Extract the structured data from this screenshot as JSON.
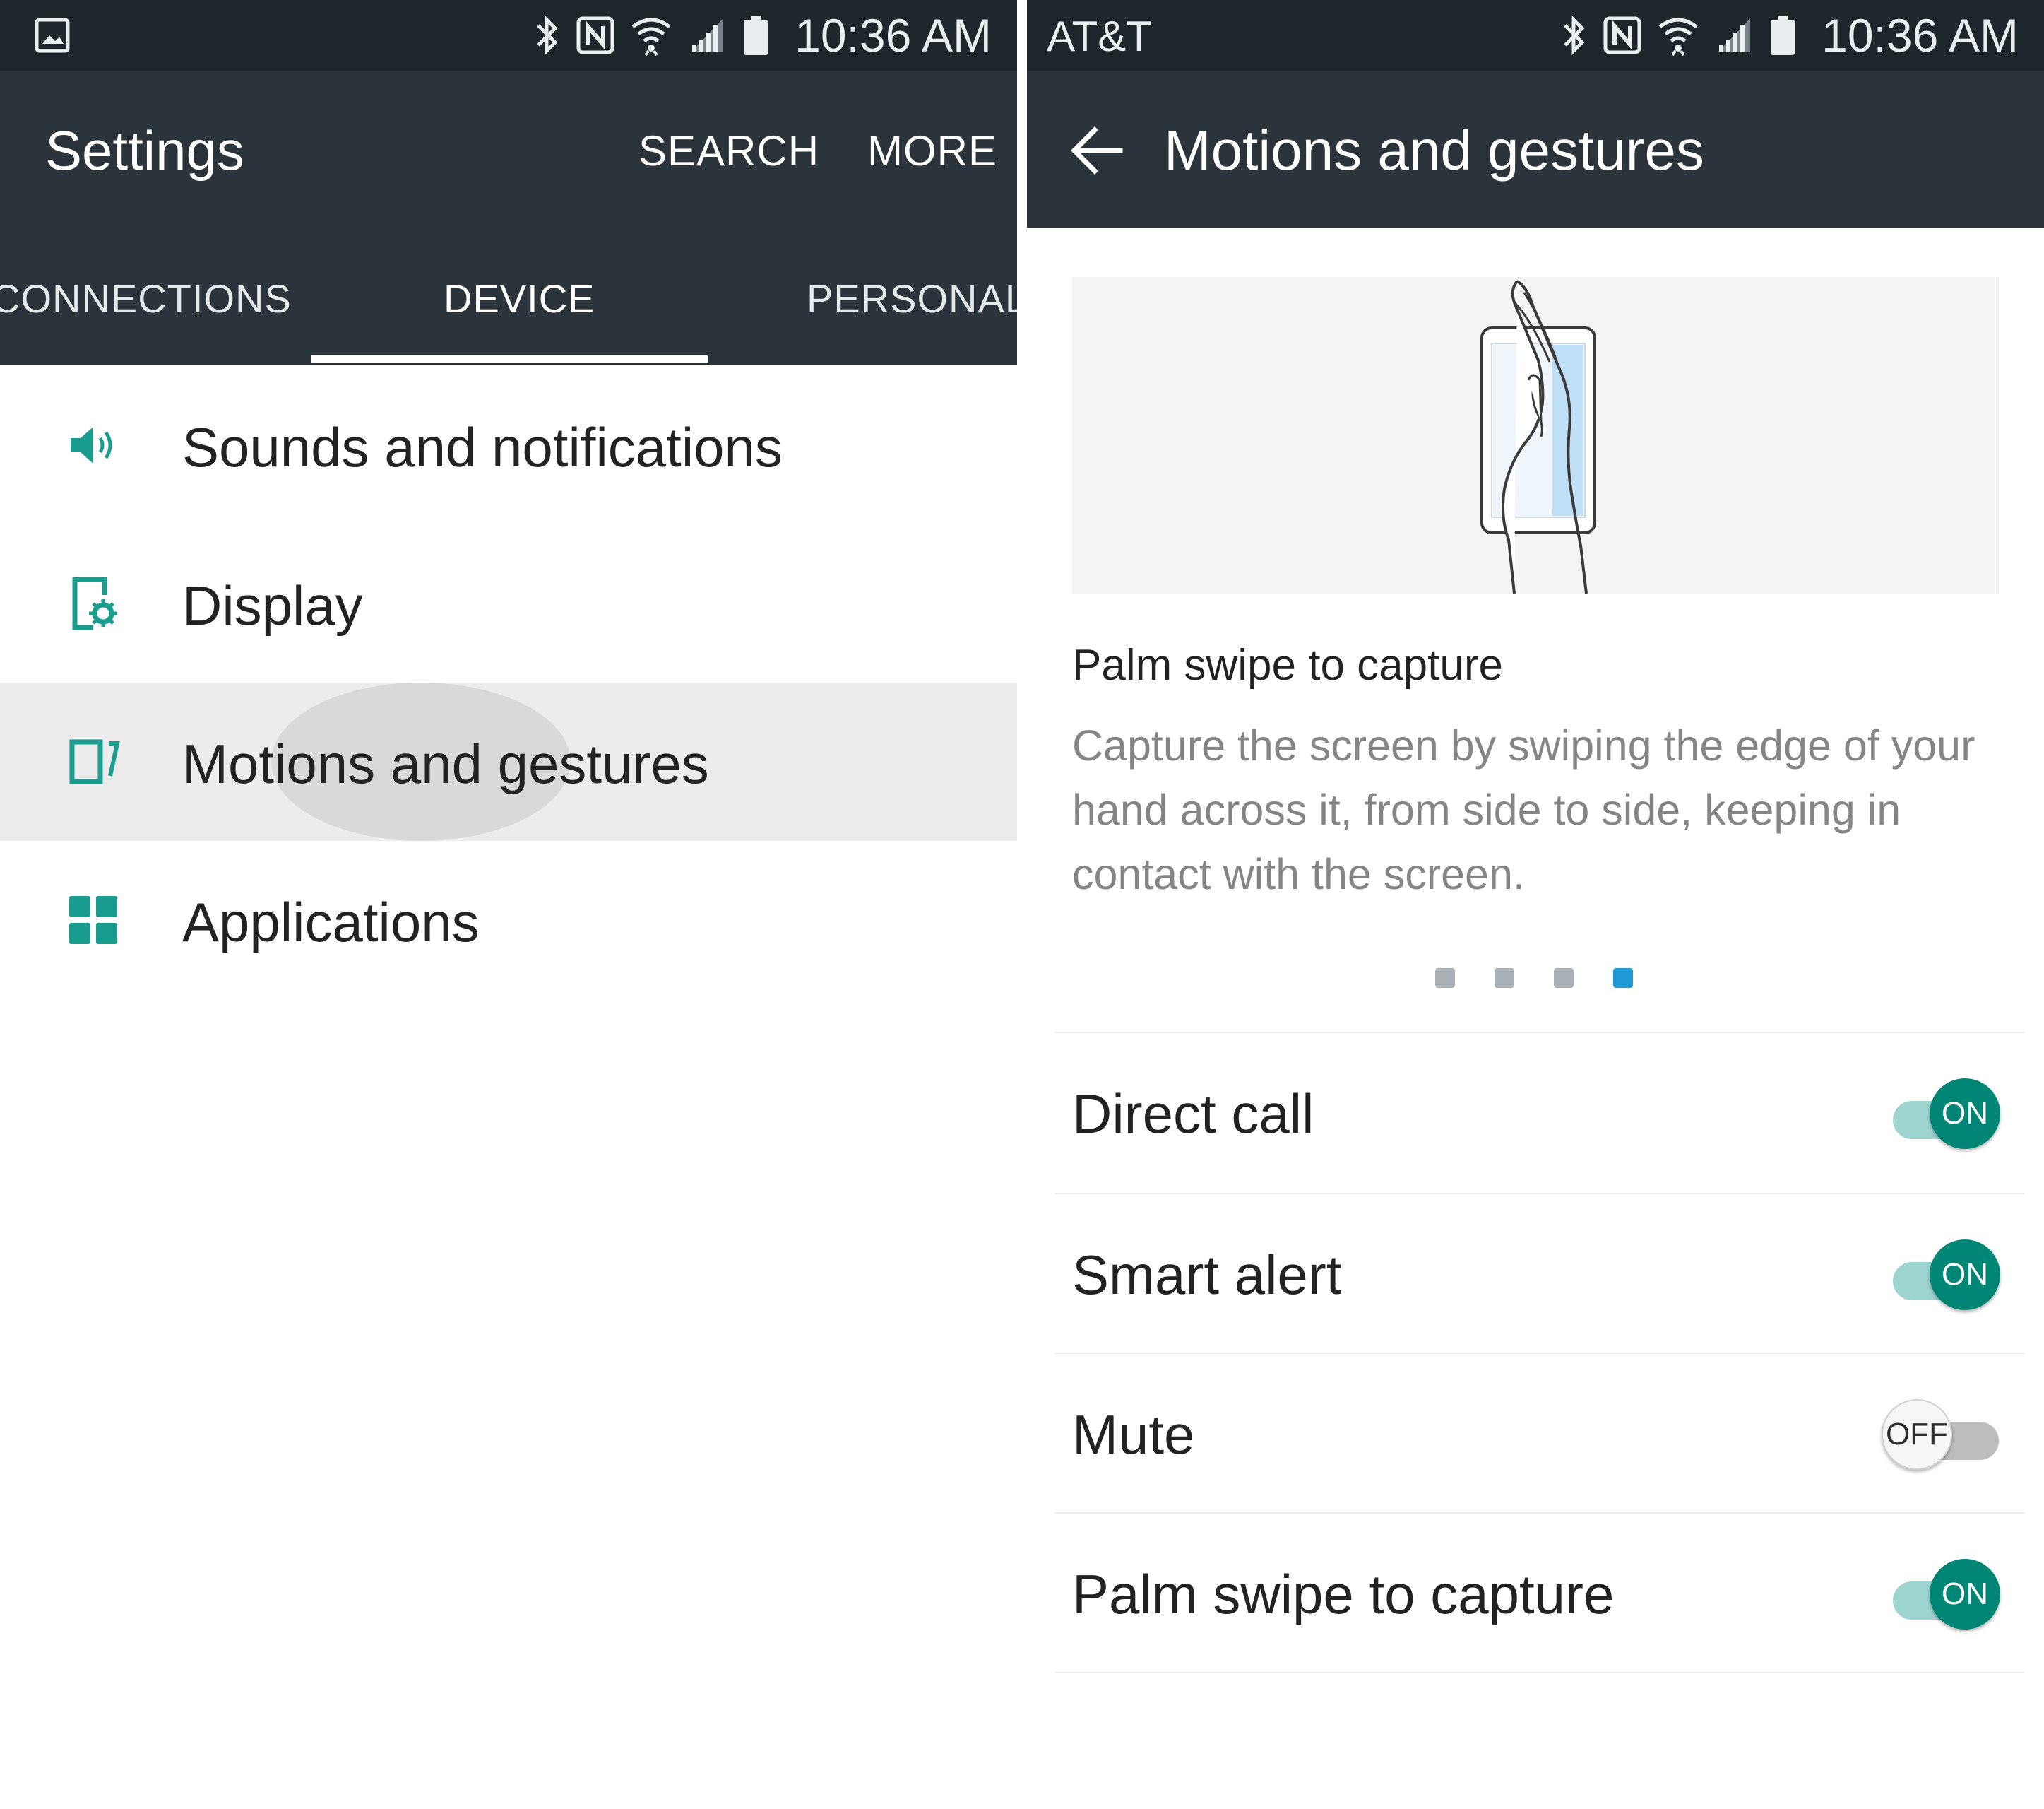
{
  "status_bar": {
    "time": "10:36 AM",
    "carrier": "AT&T",
    "icons": [
      "gallery-icon",
      "bluetooth-icon",
      "nfc-icon",
      "wifi-icon",
      "signal-icon",
      "battery-icon"
    ]
  },
  "settings": {
    "title": "Settings",
    "actions": {
      "search": "SEARCH",
      "more": "MORE"
    },
    "tabs": [
      {
        "label": "CONNECTIONS"
      },
      {
        "label": "DEVICE",
        "selected": true
      },
      {
        "label": "PERSONAL"
      }
    ],
    "items": [
      {
        "label": "Sounds and notifications",
        "icon": "speaker-icon"
      },
      {
        "label": "Display",
        "icon": "display-icon"
      },
      {
        "label": "Motions and gestures",
        "icon": "motion-icon",
        "pressed": true
      },
      {
        "label": "Applications",
        "icon": "apps-grid-icon"
      }
    ]
  },
  "motions": {
    "title": "Motions and gestures",
    "feature": {
      "title": "Palm swipe to capture",
      "description": "Capture the screen by swiping the edge of your hand across it, from side to side, keeping in contact with the screen.",
      "page_count": 4,
      "current_page": 4
    },
    "toggles": [
      {
        "label": "Direct call",
        "state": "ON"
      },
      {
        "label": "Smart alert",
        "state": "ON"
      },
      {
        "label": "Mute",
        "state": "OFF"
      },
      {
        "label": "Palm swipe to capture",
        "state": "ON"
      }
    ]
  },
  "colors": {
    "status_bar": "#1f262b",
    "app_bar": "#2b343a",
    "accent_teal": "#018574",
    "icon_teal": "#1a9d8f",
    "pager_active": "#1f9ad6",
    "pager_inactive": "#a9b1b6"
  }
}
